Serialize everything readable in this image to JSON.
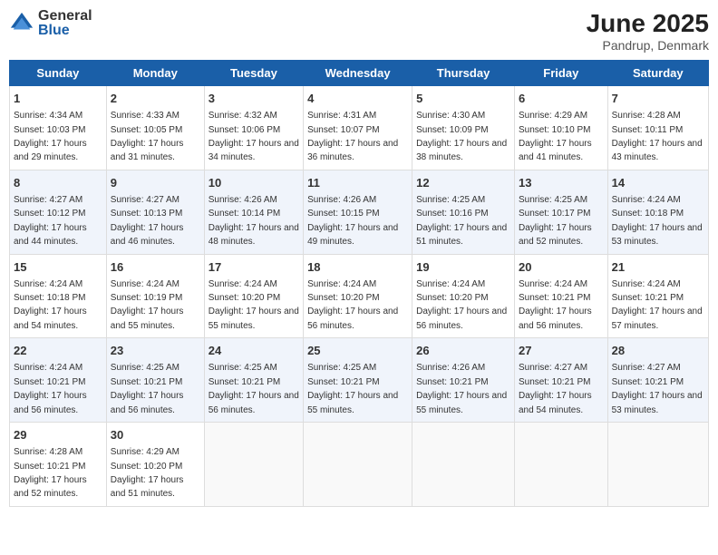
{
  "logo": {
    "general": "General",
    "blue": "Blue"
  },
  "title": "June 2025",
  "subtitle": "Pandrup, Denmark",
  "days_of_week": [
    "Sunday",
    "Monday",
    "Tuesday",
    "Wednesday",
    "Thursday",
    "Friday",
    "Saturday"
  ],
  "weeks": [
    [
      {
        "day": "1",
        "sunrise": "4:34 AM",
        "sunset": "10:03 PM",
        "daylight": "17 hours and 29 minutes."
      },
      {
        "day": "2",
        "sunrise": "4:33 AM",
        "sunset": "10:05 PM",
        "daylight": "17 hours and 31 minutes."
      },
      {
        "day": "3",
        "sunrise": "4:32 AM",
        "sunset": "10:06 PM",
        "daylight": "17 hours and 34 minutes."
      },
      {
        "day": "4",
        "sunrise": "4:31 AM",
        "sunset": "10:07 PM",
        "daylight": "17 hours and 36 minutes."
      },
      {
        "day": "5",
        "sunrise": "4:30 AM",
        "sunset": "10:09 PM",
        "daylight": "17 hours and 38 minutes."
      },
      {
        "day": "6",
        "sunrise": "4:29 AM",
        "sunset": "10:10 PM",
        "daylight": "17 hours and 41 minutes."
      },
      {
        "day": "7",
        "sunrise": "4:28 AM",
        "sunset": "10:11 PM",
        "daylight": "17 hours and 43 minutes."
      }
    ],
    [
      {
        "day": "8",
        "sunrise": "4:27 AM",
        "sunset": "10:12 PM",
        "daylight": "17 hours and 44 minutes."
      },
      {
        "day": "9",
        "sunrise": "4:27 AM",
        "sunset": "10:13 PM",
        "daylight": "17 hours and 46 minutes."
      },
      {
        "day": "10",
        "sunrise": "4:26 AM",
        "sunset": "10:14 PM",
        "daylight": "17 hours and 48 minutes."
      },
      {
        "day": "11",
        "sunrise": "4:26 AM",
        "sunset": "10:15 PM",
        "daylight": "17 hours and 49 minutes."
      },
      {
        "day": "12",
        "sunrise": "4:25 AM",
        "sunset": "10:16 PM",
        "daylight": "17 hours and 51 minutes."
      },
      {
        "day": "13",
        "sunrise": "4:25 AM",
        "sunset": "10:17 PM",
        "daylight": "17 hours and 52 minutes."
      },
      {
        "day": "14",
        "sunrise": "4:24 AM",
        "sunset": "10:18 PM",
        "daylight": "17 hours and 53 minutes."
      }
    ],
    [
      {
        "day": "15",
        "sunrise": "4:24 AM",
        "sunset": "10:18 PM",
        "daylight": "17 hours and 54 minutes."
      },
      {
        "day": "16",
        "sunrise": "4:24 AM",
        "sunset": "10:19 PM",
        "daylight": "17 hours and 55 minutes."
      },
      {
        "day": "17",
        "sunrise": "4:24 AM",
        "sunset": "10:20 PM",
        "daylight": "17 hours and 55 minutes."
      },
      {
        "day": "18",
        "sunrise": "4:24 AM",
        "sunset": "10:20 PM",
        "daylight": "17 hours and 56 minutes."
      },
      {
        "day": "19",
        "sunrise": "4:24 AM",
        "sunset": "10:20 PM",
        "daylight": "17 hours and 56 minutes."
      },
      {
        "day": "20",
        "sunrise": "4:24 AM",
        "sunset": "10:21 PM",
        "daylight": "17 hours and 56 minutes."
      },
      {
        "day": "21",
        "sunrise": "4:24 AM",
        "sunset": "10:21 PM",
        "daylight": "17 hours and 57 minutes."
      }
    ],
    [
      {
        "day": "22",
        "sunrise": "4:24 AM",
        "sunset": "10:21 PM",
        "daylight": "17 hours and 56 minutes."
      },
      {
        "day": "23",
        "sunrise": "4:25 AM",
        "sunset": "10:21 PM",
        "daylight": "17 hours and 56 minutes."
      },
      {
        "day": "24",
        "sunrise": "4:25 AM",
        "sunset": "10:21 PM",
        "daylight": "17 hours and 56 minutes."
      },
      {
        "day": "25",
        "sunrise": "4:25 AM",
        "sunset": "10:21 PM",
        "daylight": "17 hours and 55 minutes."
      },
      {
        "day": "26",
        "sunrise": "4:26 AM",
        "sunset": "10:21 PM",
        "daylight": "17 hours and 55 minutes."
      },
      {
        "day": "27",
        "sunrise": "4:27 AM",
        "sunset": "10:21 PM",
        "daylight": "17 hours and 54 minutes."
      },
      {
        "day": "28",
        "sunrise": "4:27 AM",
        "sunset": "10:21 PM",
        "daylight": "17 hours and 53 minutes."
      }
    ],
    [
      {
        "day": "29",
        "sunrise": "4:28 AM",
        "sunset": "10:21 PM",
        "daylight": "17 hours and 52 minutes."
      },
      {
        "day": "30",
        "sunrise": "4:29 AM",
        "sunset": "10:20 PM",
        "daylight": "17 hours and 51 minutes."
      },
      null,
      null,
      null,
      null,
      null
    ]
  ]
}
